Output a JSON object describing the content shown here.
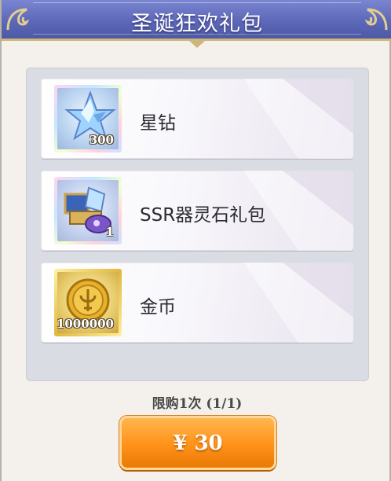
{
  "header": {
    "title": "圣诞狂欢礼包"
  },
  "items": [
    {
      "name": "星钻",
      "quantity": "300",
      "icon": "star-diamond-icon"
    },
    {
      "name": "SSR器灵石礼包",
      "quantity": "1",
      "icon": "spirit-stone-chest-icon"
    },
    {
      "name": "金币",
      "quantity": "1000000",
      "icon": "gold-coin-icon"
    }
  ],
  "purchase": {
    "limit_text": "限购1次 (1/1)",
    "price_label": "¥ 30"
  },
  "colors": {
    "header": "#5a66b6",
    "button": "#ff9219",
    "panel": "#d9dde3"
  }
}
